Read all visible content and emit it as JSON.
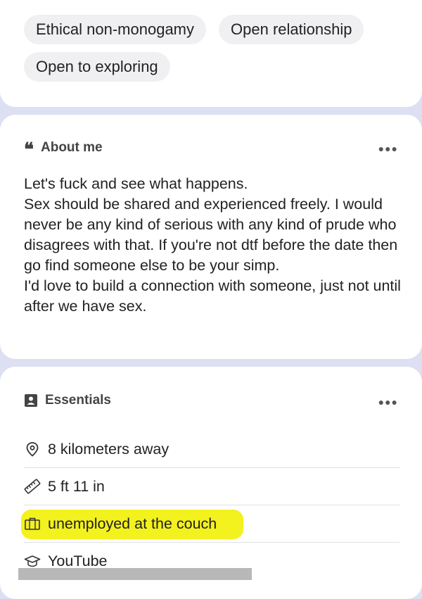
{
  "tags": {
    "row1": [
      "Ethical non-monogamy",
      "Open relationship"
    ],
    "row2": [
      "Open to exploring"
    ]
  },
  "about": {
    "title": "About me",
    "lines": [
      "Let's fuck and see what happens.",
      "Sex should be shared and experienced freely. I would never be any kind of serious with any kind of prude who disagrees with that. If you're not dtf before the date then go find someone else to be your simp.",
      "I'd love to build a connection with someone, just not until after we have sex."
    ]
  },
  "essentials": {
    "title": "Essentials",
    "items": [
      {
        "icon": "location-pin-icon",
        "label": "8 kilometers away"
      },
      {
        "icon": "ruler-icon",
        "label": "5 ft 11 in"
      },
      {
        "icon": "briefcase-icon",
        "label": "unemployed at the couch"
      },
      {
        "icon": "graduation-cap-icon",
        "label": "YouTube"
      }
    ]
  },
  "colors": {
    "page_bg": "#dde0f3",
    "card_bg": "#ffffff",
    "tag_bg": "#f0f0f2",
    "highlight": "#f3f11e"
  }
}
